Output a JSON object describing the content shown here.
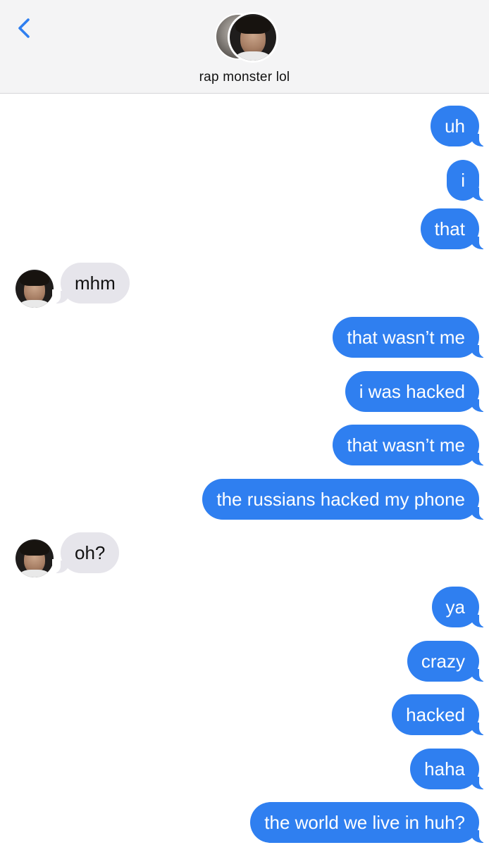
{
  "header": {
    "contact_name": "rap monster lol",
    "back_icon": "chevron-left-icon",
    "accent_color": "#2f7ff0"
  },
  "messages": [
    {
      "direction": "out",
      "text": "uh"
    },
    {
      "direction": "out",
      "text": "i"
    },
    {
      "direction": "out",
      "text": "that"
    },
    {
      "direction": "in",
      "text": "mhm"
    },
    {
      "direction": "out",
      "text": "that wasn’t me"
    },
    {
      "direction": "out",
      "text": "i was hacked"
    },
    {
      "direction": "out",
      "text": "that wasn’t me"
    },
    {
      "direction": "out",
      "text": "the russians hacked my phone"
    },
    {
      "direction": "in",
      "text": "oh?"
    },
    {
      "direction": "out",
      "text": "ya"
    },
    {
      "direction": "out",
      "text": "crazy"
    },
    {
      "direction": "out",
      "text": "hacked"
    },
    {
      "direction": "out",
      "text": "haha"
    },
    {
      "direction": "out",
      "text": "the world we live in huh?"
    }
  ],
  "colors": {
    "outgoing_bubble": "#2f7ff0",
    "incoming_bubble": "#e6e5eb",
    "header_background": "#f4f4f5"
  }
}
